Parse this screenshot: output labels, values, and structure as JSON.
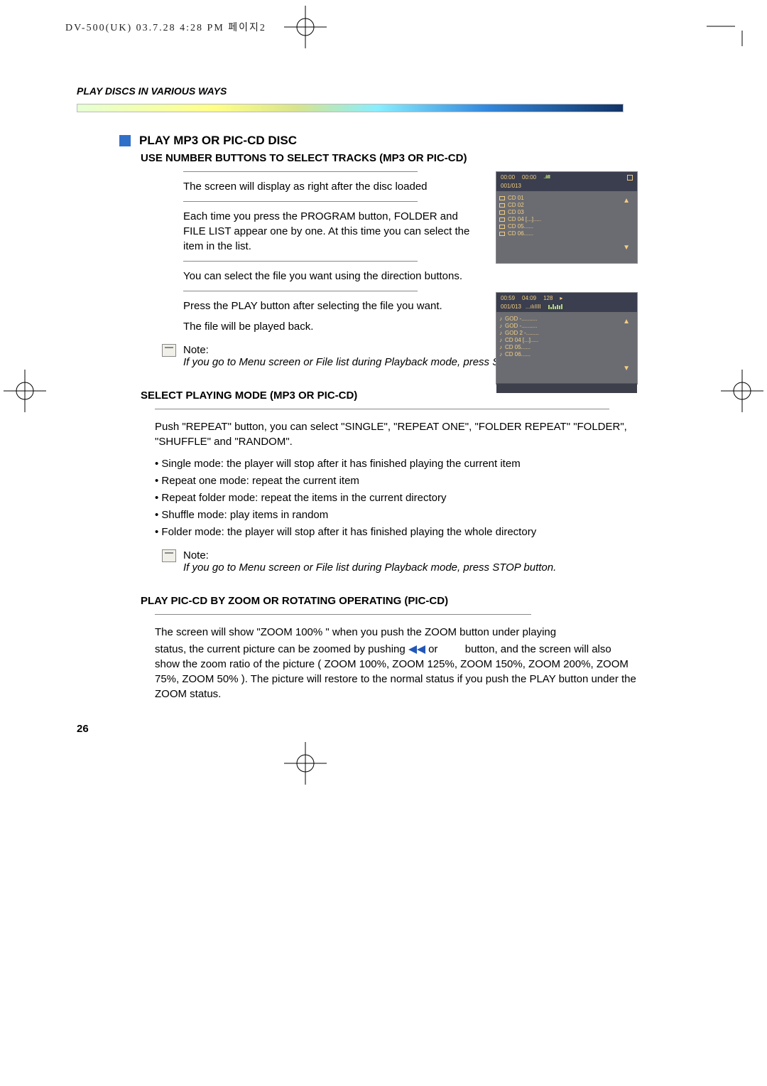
{
  "print_header": "DV-500(UK)  03.7.28 4:28 PM  페이지2",
  "section_label": "PLAY DISCS IN VARIOUS WAYS",
  "h1": "PLAY MP3 OR PIC-CD DISC",
  "h2_a": "USE NUMBER BUTTONS TO SELECT TRACKS (MP3 OR PIC-CD)",
  "instr1": "The screen will display as right after the disc loaded",
  "instr2": "Each time you press the PROGRAM button, FOLDER and FILE LIST appear one by one. At this time you can select the item in the list.",
  "instr3": "You can select the file you want using the direction buttons.",
  "instr4": "Press the PLAY button after selecting the file you want.",
  "instr5": "The file will be played back.",
  "note_label": "Note:",
  "note1_text": "If you go to Menu screen or File list during Playback mode, press STOP button.",
  "h2_b": "SELECT PLAYING MODE (MP3 OR PIC-CD)",
  "mode_intro": "Push \"REPEAT\" button, you can select \"SINGLE\", \"REPEAT ONE\", \"FOLDER REPEAT\" \"FOLDER\", \"SHUFFLE\" and \"RANDOM\".",
  "bullets": [
    "Single mode: the player will stop after it has finished playing the current item",
    "Repeat one mode: repeat the current item",
    "Repeat folder mode: repeat the items in the current directory",
    "Shuffle mode: play items in random",
    "Folder mode: the player will stop after it has finished playing the whole directory"
  ],
  "note2_text": "If you go to Menu screen or File list during Playback mode, press STOP button.",
  "h2_c": "PLAY PIC-CD BY ZOOM OR ROTATING OPERATING (PIC-CD)",
  "zoom_p1a": "The screen will show \"ZOOM 100% \" when you push the ZOOM button under playing",
  "zoom_p1b": "status, the current picture can be zoomed by pushing",
  "zoom_p1c": "or",
  "zoom_p1d": "button, and the screen will also show the zoom  ratio of the picture ( ZOOM 100%, ZOOM 125%, ZOOM 150%, ZOOM 200%, ZOOM 75%, ZOOM 50% ). The picture will restore to the normal status if you push the PLAY button under the ZOOM status.",
  "page_number": "26",
  "screen1": {
    "time_a": "00:00",
    "time_b": "00:00",
    "track": "001/013",
    "files": [
      "CD 01",
      "CD 02",
      "CD 03",
      "CD 04  [...].....",
      "CD 05......",
      "CD 06......"
    ]
  },
  "screen2": {
    "time_a": "00:59",
    "time_b": "04:09",
    "bitrate": "128",
    "track": "001/013",
    "files": [
      "GOD -..........",
      "GOD -..........",
      "GOD 2 -........",
      "CD 04  [...].....",
      "CD 05......",
      "CD 06......"
    ]
  }
}
